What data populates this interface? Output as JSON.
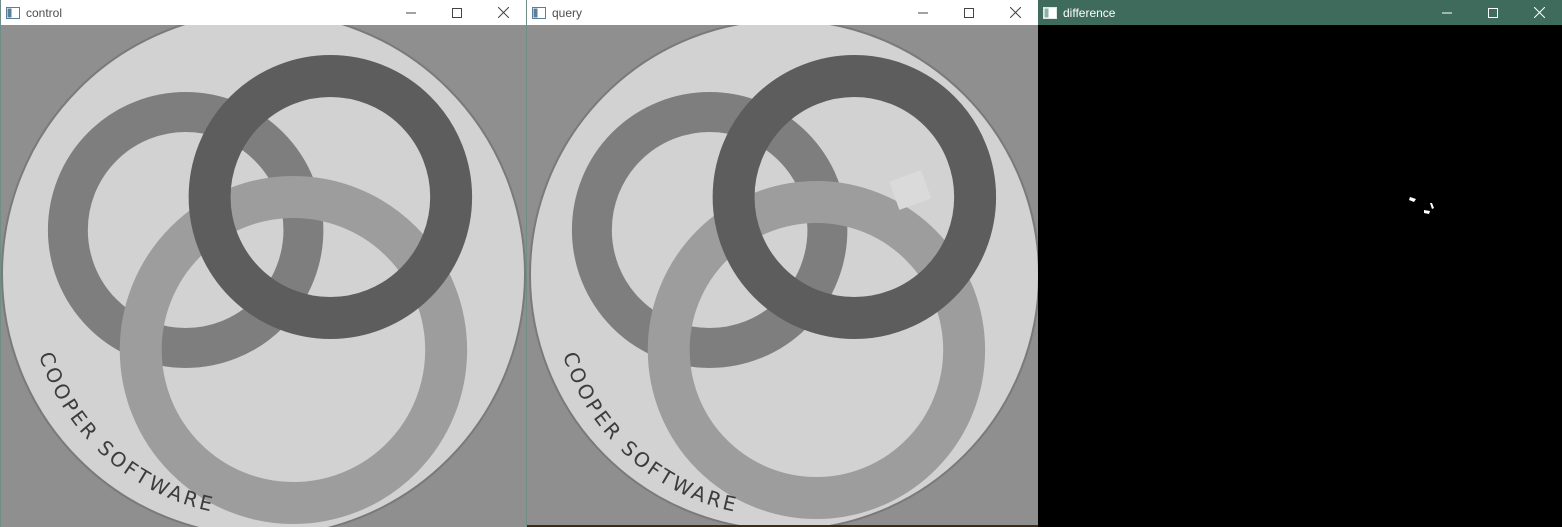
{
  "windows": {
    "control": {
      "title": "control",
      "image": "grayscale photo of a circular coaster with three interlocking rings and curved text",
      "image_text": "COOPER SOFTWARE"
    },
    "query": {
      "title": "query",
      "image": "grayscale photo of the same coaster with a small bright patch near the top-right ring",
      "image_text": "COOPER SOFTWARE"
    },
    "difference": {
      "title": "difference",
      "image": "black difference mask with a few small white specks"
    }
  },
  "icons": {
    "app": "window-app-icon",
    "minimize": "minimize-icon",
    "maximize": "maximize-icon",
    "close": "close-icon"
  },
  "colors": {
    "active_titlebar": "#3f6b5c",
    "inactive_titlebar": "#ffffff",
    "difference_background": "#000000"
  }
}
